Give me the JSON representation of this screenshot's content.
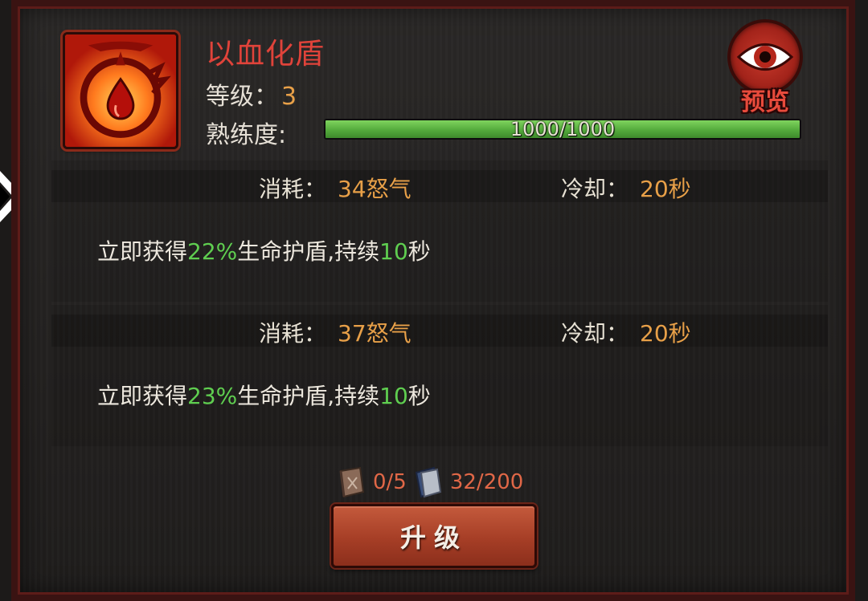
{
  "skill": {
    "name": "以血化盾",
    "icon": "blood-drop-shield-icon",
    "level_label": "等级：",
    "level_value": "3",
    "proficiency_label": "熟练度:",
    "proficiency_text": "1000/1000",
    "proficiency_fraction": 1.0
  },
  "preview": {
    "label": "预览",
    "icon": "eye-icon"
  },
  "levels": [
    {
      "cost_label": "消耗：",
      "cost_value": "34怒气",
      "cooldown_label": "冷却：",
      "cooldown_value": "20秒",
      "desc_prefix": "立即获得",
      "desc_pct": "22%",
      "desc_mid": "生命护盾,持续",
      "desc_dur": "10",
      "desc_suffix": "秒"
    },
    {
      "cost_label": "消耗：",
      "cost_value": "37怒气",
      "cooldown_label": "冷却：",
      "cooldown_value": "20秒",
      "desc_prefix": "立即获得",
      "desc_pct": "23%",
      "desc_mid": "生命护盾,持续",
      "desc_dur": "10",
      "desc_suffix": "秒"
    }
  ],
  "materials": {
    "book1_icon": "skill-book-brown-icon",
    "book1_count": "0/5",
    "book2_icon": "skill-book-blue-icon",
    "book2_count": "32/200"
  },
  "upgrade_button": {
    "label": "升级"
  },
  "colors": {
    "skill_name": "#e0433a",
    "value_orange": "#e8a048",
    "highlight_green": "#5fce50",
    "material_text": "#e06747",
    "progress_fill": "#54ab3c"
  }
}
